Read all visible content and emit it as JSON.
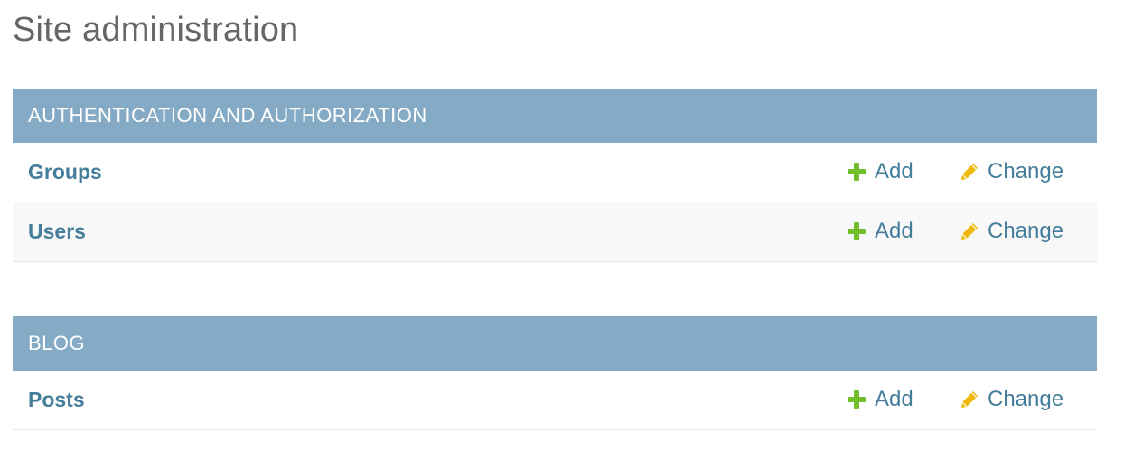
{
  "page": {
    "title": "Site administration"
  },
  "colors": {
    "caption_bg": "#84aac5",
    "link": "#447e9b",
    "add_icon": "#70bf2b",
    "change_icon": "#efb80b"
  },
  "modules": [
    {
      "caption": "AUTHENTICATION AND AUTHORIZATION",
      "models": [
        {
          "name": "Groups",
          "add_label": "Add",
          "change_label": "Change"
        },
        {
          "name": "Users",
          "add_label": "Add",
          "change_label": "Change"
        }
      ]
    },
    {
      "caption": "BLOG",
      "models": [
        {
          "name": "Posts",
          "add_label": "Add",
          "change_label": "Change"
        }
      ]
    }
  ]
}
